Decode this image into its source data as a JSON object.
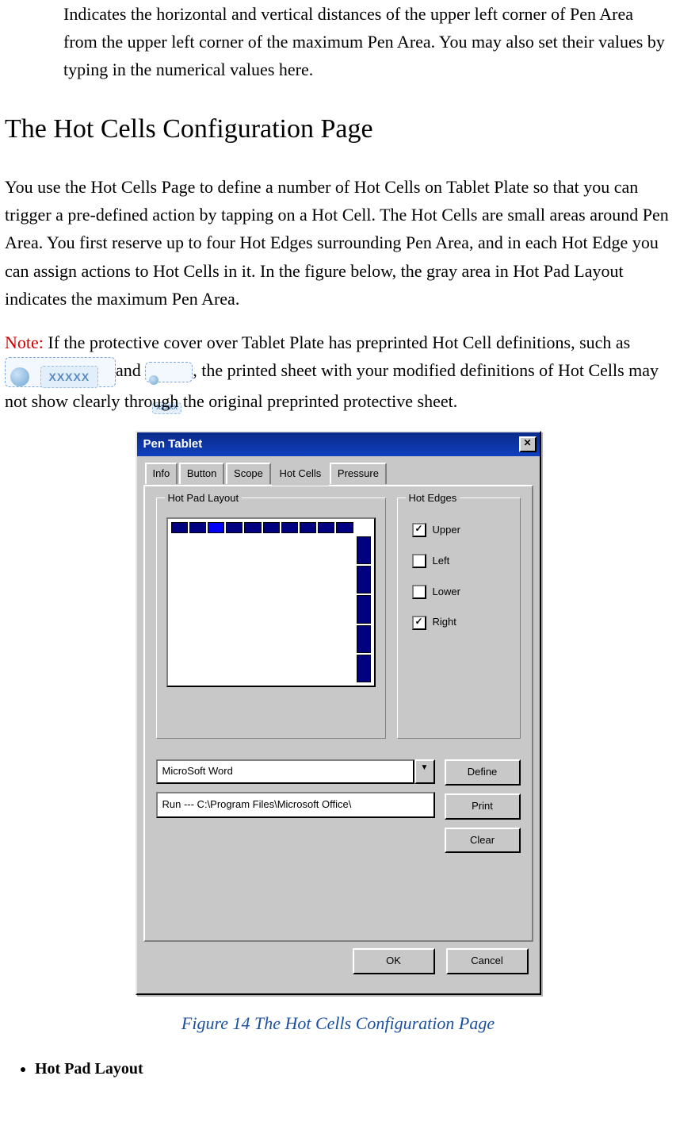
{
  "intro_para": "Indicates the horizontal and vertical distances of the upper left corner of Pen Area from the upper left corner of the maximum Pen Area. You may also set their values by typing in the numerical values here.",
  "section_heading": "The Hot Cells Configuration Page",
  "body_para": "You use the Hot Cells Page to define a number of Hot Cells on Tablet Plate so that you can trigger a pre-defined action by tapping on a Hot Cell. The Hot Cells are small areas around Pen Area. You first reserve up to four Hot Edges surrounding Pen Area, and in each Hot Edge you can assign actions to Hot Cells in it. In the figure below, the gray area in Hot Pad Layout indicates the maximum Pen Area.",
  "note_label": "Note:",
  "note_text_1": " If the protective cover over Tablet Plate has preprinted Hot Cell definitions, such as ",
  "note_text_2": "and  ",
  "note_text_3": ", the printed sheet with your modified definitions of Hot Cells may not show clearly through the original preprinted protective sheet.",
  "badge_large_text": "XXXXX",
  "badge_small_text": "XXXXX",
  "dialog": {
    "title": "Pen Tablet",
    "tabs": [
      "Info",
      "Button",
      "Scope",
      "Hot Cells",
      "Pressure"
    ],
    "active_tab": "Hot Cells",
    "group_layout_label": "Hot Pad Layout",
    "group_edges_label": "Hot Edges",
    "edges": [
      {
        "label": "Upper",
        "checked": true
      },
      {
        "label": "Left",
        "checked": false
      },
      {
        "label": "Lower",
        "checked": false
      },
      {
        "label": "Right",
        "checked": true
      }
    ],
    "combo_value": "MicroSoft Word",
    "list_value": "Run --- C:\\Program Files\\Microsoft Office\\",
    "buttons": {
      "define": "Define",
      "print": "Print",
      "clear": "Clear"
    },
    "ok": "OK",
    "cancel": "Cancel"
  },
  "caption": "Figure 14 The Hot Cells Configuration Page",
  "bullet_1": "Hot Pad Layout"
}
